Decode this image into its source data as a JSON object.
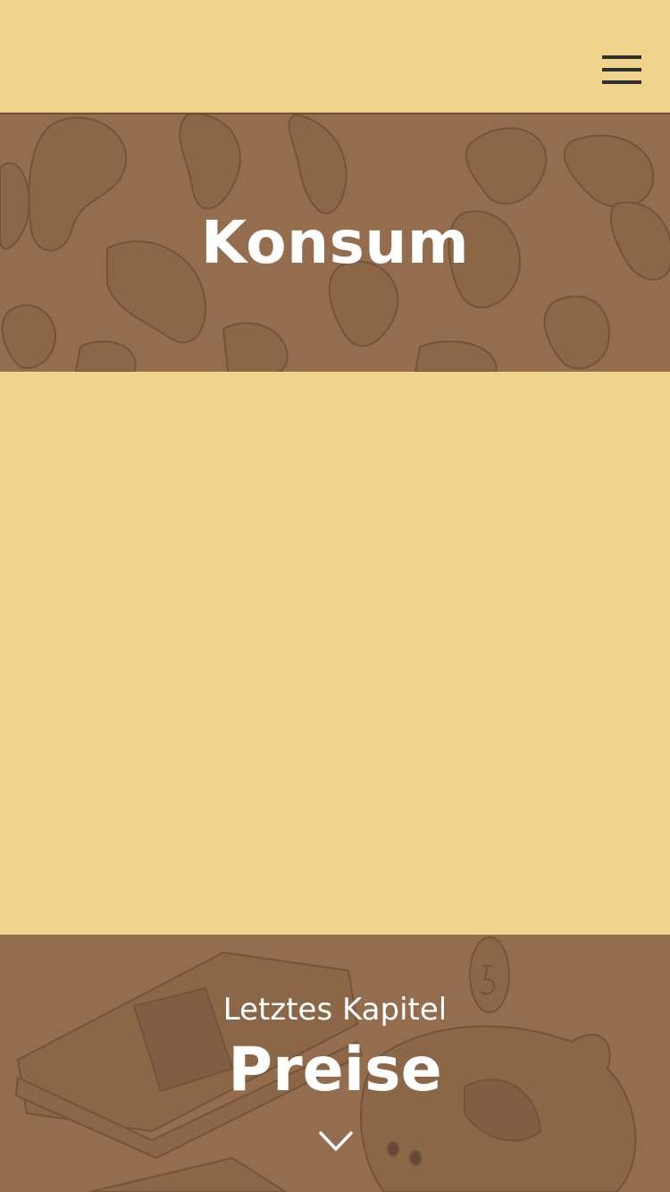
{
  "header": {
    "menu_icon": "hamburger-menu-icon"
  },
  "hero": {
    "title": "Konsum",
    "background_pattern": "chips-illustration"
  },
  "next_chapter": {
    "label": "Letztes Kapitel",
    "title": "Preise",
    "arrow_icon": "chevron-down-icon",
    "background_pattern": "money-piggy-bank-illustration"
  },
  "colors": {
    "page_background": "#f0d48e",
    "band_background": "#936d4d",
    "pattern_stroke": "#7a5a3e",
    "text_light": "#ffffff",
    "icon_dark": "#2f2f2f"
  }
}
